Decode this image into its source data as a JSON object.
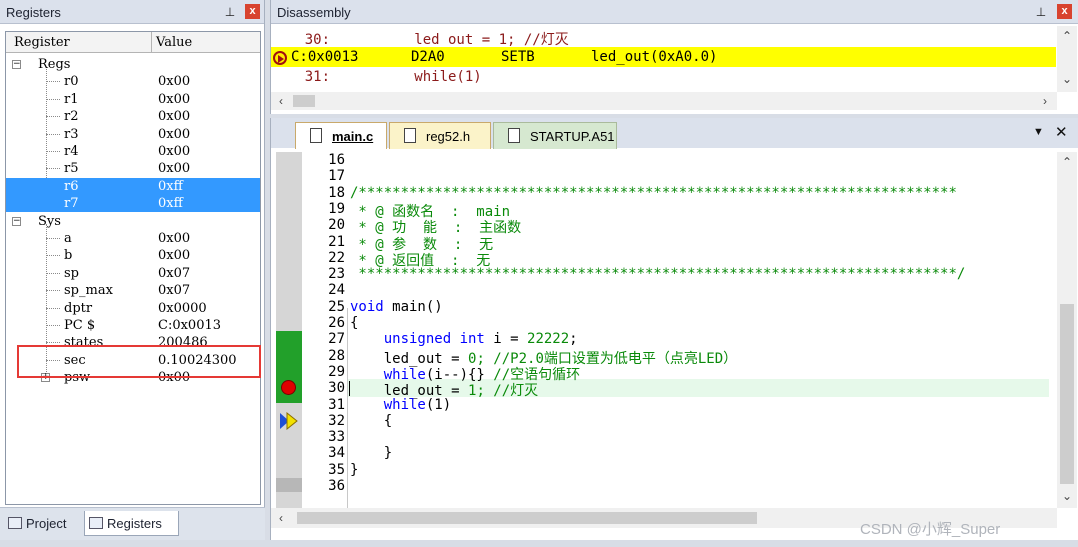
{
  "registers_panel": {
    "title": "Registers",
    "pin_icon": "pin-icon",
    "close_label": "x",
    "columns": [
      "Register",
      "Value"
    ],
    "groups": [
      {
        "name": "Regs",
        "expander": "−"
      },
      {
        "name": "Sys",
        "expander": "−"
      }
    ],
    "regs": [
      {
        "name": "r0",
        "value": "0x00"
      },
      {
        "name": "r1",
        "value": "0x00"
      },
      {
        "name": "r2",
        "value": "0x00"
      },
      {
        "name": "r3",
        "value": "0x00"
      },
      {
        "name": "r4",
        "value": "0x00"
      },
      {
        "name": "r5",
        "value": "0x00"
      },
      {
        "name": "r6",
        "value": "0xff"
      },
      {
        "name": "r7",
        "value": "0xff"
      }
    ],
    "sys": [
      {
        "name": "a",
        "value": "0x00"
      },
      {
        "name": "b",
        "value": "0x00"
      },
      {
        "name": "sp",
        "value": "0x07"
      },
      {
        "name": "sp_max",
        "value": "0x07"
      },
      {
        "name": "dptr",
        "value": "0x0000"
      },
      {
        "name": "PC  $",
        "value": "C:0x0013"
      },
      {
        "name": "states",
        "value": "200486"
      },
      {
        "name": "sec",
        "value": "0.10024300"
      },
      {
        "name": "psw",
        "value": "0x00",
        "expander": "+"
      }
    ],
    "tabs": [
      {
        "label": "Project"
      },
      {
        "label": "Registers"
      }
    ]
  },
  "disassembly": {
    "title": "Disassembly",
    "close_label": "x",
    "lines": [
      {
        "text": "    30:          led_out = 1; //灯灭"
      },
      {
        "addr": "C:0x0013",
        "opcode": "D2A0",
        "mnemonic": "SETB",
        "operand": "led_out(0xA0.0)"
      },
      {
        "text": "    31:          while(1)"
      }
    ]
  },
  "editor": {
    "tabs": [
      {
        "label": "main.c"
      },
      {
        "label": "reg52.h"
      },
      {
        "label": "STARTUP.A51"
      }
    ],
    "menu_glyph": "▼",
    "close_glyph": "✕",
    "lines": [
      {
        "num": "16",
        "text": "",
        "cls": "pl"
      },
      {
        "num": "17",
        "text": "",
        "cls": "pl"
      },
      {
        "num": "18",
        "text": "/***********************************************************************",
        "cls": "cm"
      },
      {
        "num": "19",
        "text": " * @ 函数名  :  main",
        "cls": "cm"
      },
      {
        "num": "20",
        "text": " * @ 功  能  :  主函数",
        "cls": "cm"
      },
      {
        "num": "21",
        "text": " * @ 参  数  :  无",
        "cls": "cm"
      },
      {
        "num": "22",
        "text": " * @ 返回值  :  无",
        "cls": "cm"
      },
      {
        "num": "23",
        "text": " ***********************************************************************/",
        "cls": "cm"
      },
      {
        "num": "24",
        "text": "",
        "cls": "pl"
      },
      {
        "num": "25",
        "parts": [
          {
            "t": "void",
            "c": "kw"
          },
          {
            "t": " main()",
            "c": "pl"
          }
        ]
      },
      {
        "num": "26",
        "text": "{",
        "cls": "pl"
      },
      {
        "num": "27",
        "parts": [
          {
            "t": "    unsigned int",
            "c": "kw"
          },
          {
            "t": " i = ",
            "c": "pl"
          },
          {
            "t": "22222",
            "c": "cm"
          },
          {
            "t": ";",
            "c": "pl"
          }
        ]
      },
      {
        "num": "28",
        "parts": [
          {
            "t": "    led_out = ",
            "c": "pl"
          },
          {
            "t": "0",
            "c": "cm"
          },
          {
            "t": "; //P2.0端口设置为低电平（点亮LED）",
            "c": "cm"
          }
        ]
      },
      {
        "num": "29",
        "parts": [
          {
            "t": "    while",
            "c": "kw"
          },
          {
            "t": "(i--){} ",
            "c": "pl"
          },
          {
            "t": "//空语句循环",
            "c": "cm"
          }
        ]
      },
      {
        "num": "30",
        "parts": [
          {
            "t": "    led_out = ",
            "c": "pl"
          },
          {
            "t": "1",
            "c": "cm"
          },
          {
            "t": "; //灯灭",
            "c": "cm"
          }
        ]
      },
      {
        "num": "31",
        "parts": [
          {
            "t": "    while",
            "c": "kw"
          },
          {
            "t": "(1)",
            "c": "pl"
          }
        ]
      },
      {
        "num": "32",
        "text": "    {",
        "cls": "pl"
      },
      {
        "num": "33",
        "text": "",
        "cls": "pl"
      },
      {
        "num": "34",
        "text": "    }",
        "cls": "pl"
      },
      {
        "num": "35",
        "text": "}",
        "cls": "pl"
      },
      {
        "num": "36",
        "text": "",
        "cls": "pl"
      }
    ]
  },
  "watermark": "CSDN @小辉_Super"
}
